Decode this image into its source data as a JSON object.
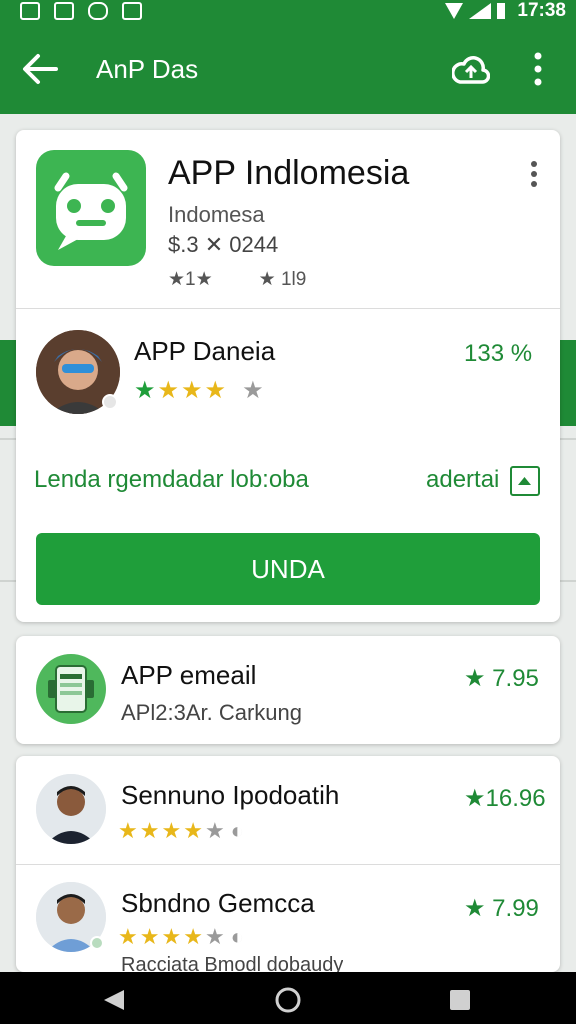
{
  "status_bar": {
    "time": "17:38"
  },
  "app_bar": {
    "title": "AnP Das"
  },
  "header_app": {
    "name": "APP Indlomesia",
    "publisher": "Indomesa",
    "price_line": "$.3 ✕ 0244",
    "rating_a": "★1★",
    "rating_b": "★ 1l9"
  },
  "review": {
    "name": "APP Daneia",
    "percent": "133 %",
    "description": "Lenda rgemdadar lob:oba",
    "detail_link": "adertai",
    "button_label": "UNDA"
  },
  "list": [
    {
      "title": "APP emeail",
      "subtitle": "APl2:3Ar. Carkung",
      "price": "★ 7.95"
    },
    {
      "title": "Sennuno Ipodoatih",
      "price": "★16.96"
    },
    {
      "title": "Sbndno Gemcca",
      "price": "★ 7.99",
      "subtitle": "Racciata Bmodl dobaudy"
    }
  ],
  "colors": {
    "primary": "#1f8a36",
    "accent": "#1f9e3a",
    "star": "#e8b71a"
  }
}
